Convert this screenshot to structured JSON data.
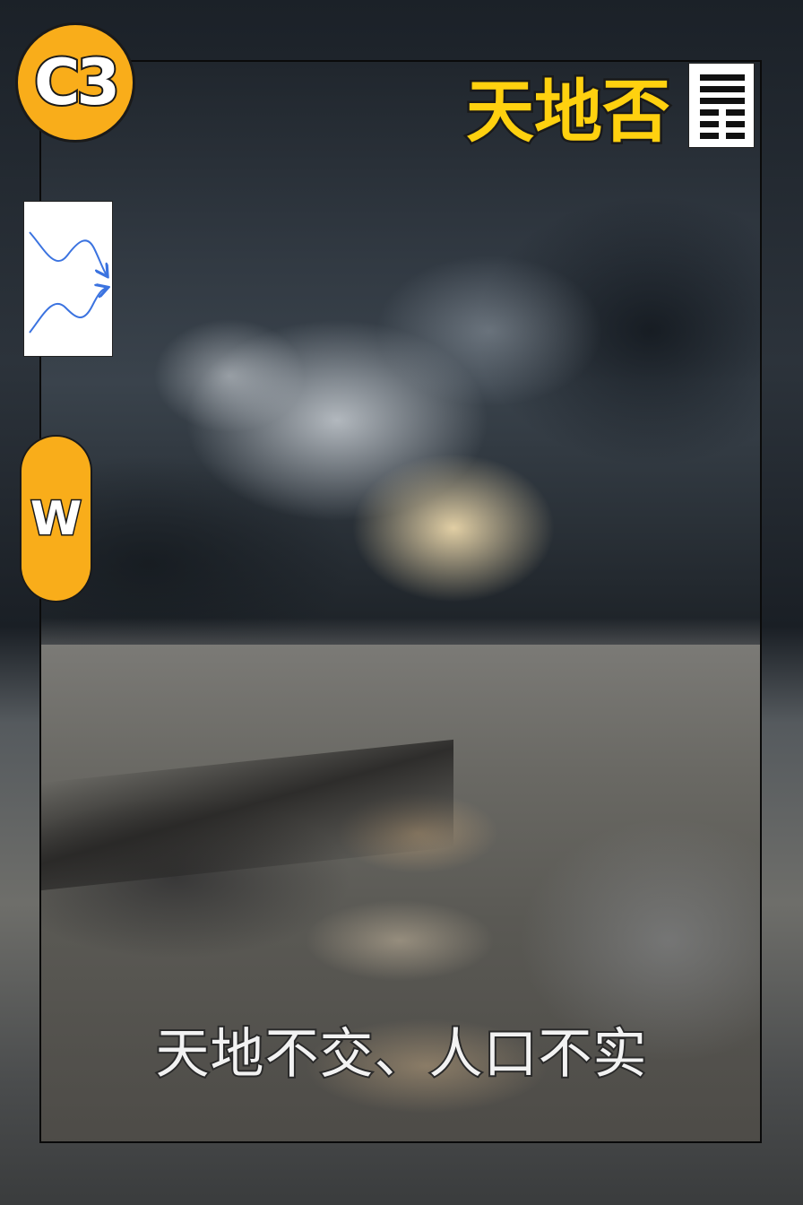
{
  "badge": {
    "label": "C3"
  },
  "title": "天地否",
  "side_badge": {
    "label": "W"
  },
  "caption": "天地不交、人口不实",
  "hexagram": {
    "name": "hexagram-pi",
    "lines": [
      "solid",
      "solid",
      "solid",
      "broken",
      "broken",
      "broken"
    ]
  },
  "colors": {
    "accent": "#f9ad1a",
    "title": "#ffd10f",
    "trend_line": "#3b73e0"
  }
}
